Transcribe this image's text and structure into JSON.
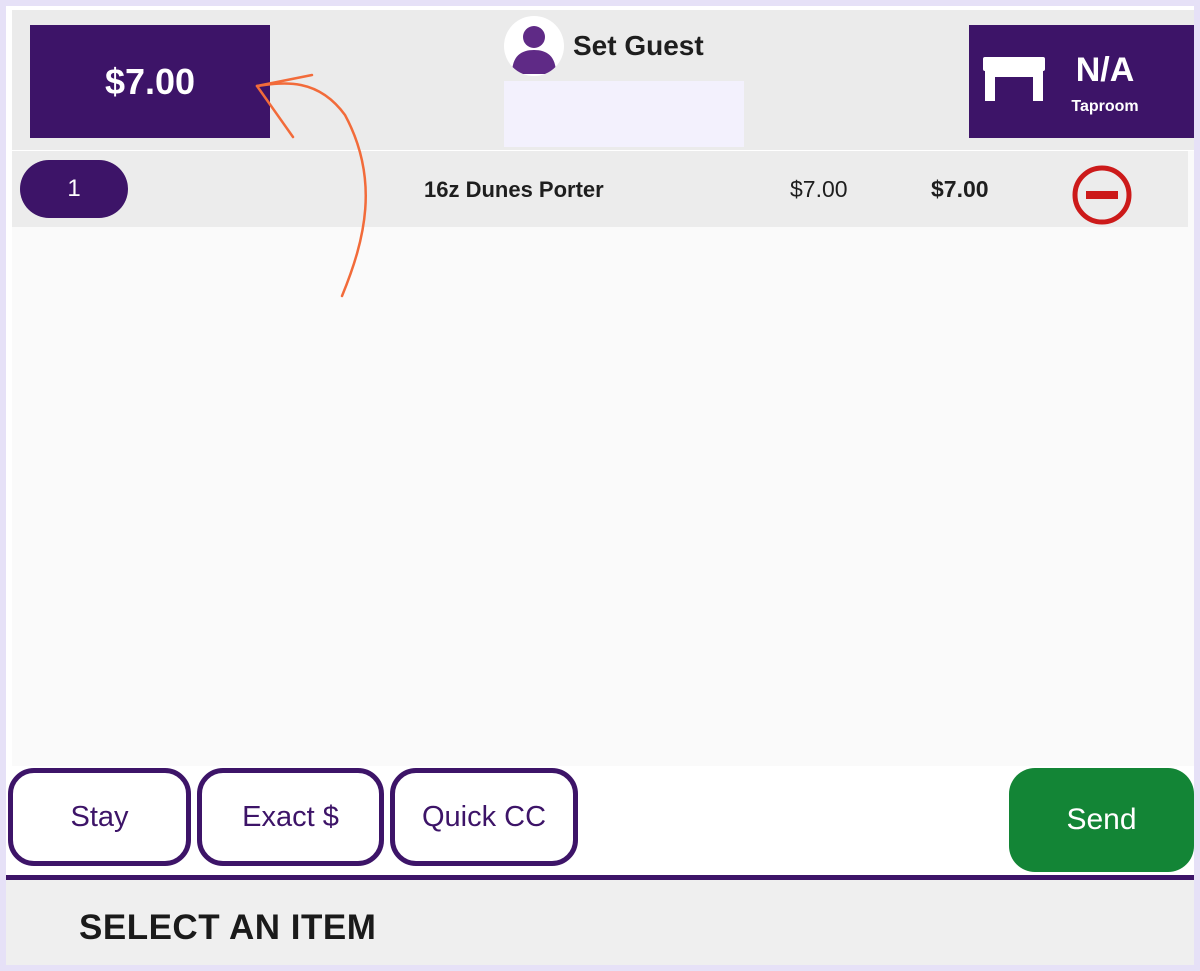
{
  "header": {
    "total": "$7.00",
    "guest": {
      "label": "Set Guest",
      "field_value": ""
    },
    "table": {
      "name": "N/A",
      "area": "Taproom"
    }
  },
  "order": {
    "items": [
      {
        "qty": "1",
        "name": "16z Dunes Porter",
        "unit_price": "$7.00",
        "line_total": "$7.00"
      }
    ]
  },
  "actions": {
    "stay": "Stay",
    "exact": "Exact $",
    "quick_cc": "Quick CC",
    "send": "Send"
  },
  "status": {
    "text": "SELECT AN ITEM"
  },
  "colors": {
    "brand": "#3d1468",
    "send": "#138536",
    "remove": "#cc1a1a",
    "annotation": "#f26b3a"
  },
  "icons": {
    "guest": "person-icon",
    "table": "table-icon",
    "remove": "minus-circle-icon"
  }
}
